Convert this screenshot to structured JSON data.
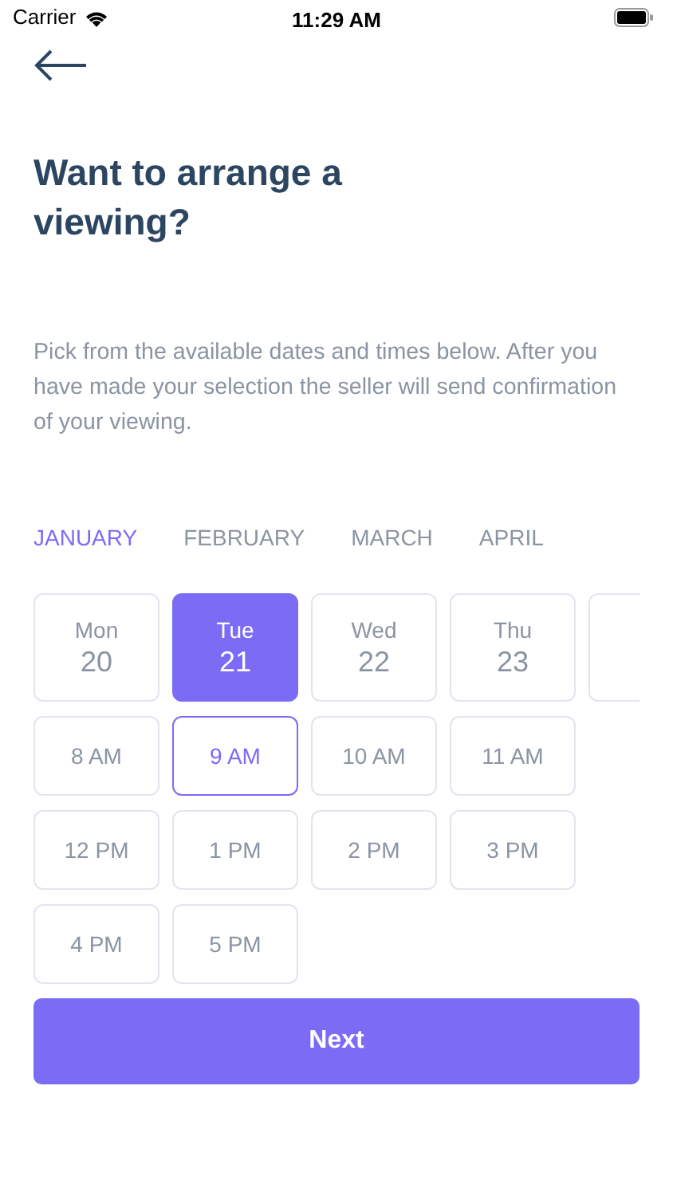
{
  "status_bar": {
    "carrier": "Carrier",
    "time": "11:29 AM"
  },
  "title": "Want to arrange a viewing?",
  "description": "Pick from the available dates and times below. After you have made your selection the seller will send confirmation of your viewing.",
  "months": [
    {
      "label": "JANUARY",
      "selected": true
    },
    {
      "label": "FEBRUARY",
      "selected": false
    },
    {
      "label": "MARCH",
      "selected": false
    },
    {
      "label": "APRIL",
      "selected": false
    }
  ],
  "days": [
    {
      "kind": "day",
      "weekday": "Mon",
      "date": "20",
      "selected": false
    },
    {
      "kind": "day",
      "weekday": "Tue",
      "date": "21",
      "selected": true
    },
    {
      "kind": "day",
      "weekday": "Wed",
      "date": "22",
      "selected": false
    },
    {
      "kind": "day",
      "weekday": "Thu",
      "date": "23",
      "selected": false
    },
    {
      "kind": "partial",
      "selected": false
    }
  ],
  "times": [
    {
      "label": "8 AM",
      "selected": false
    },
    {
      "label": "9 AM",
      "selected": true
    },
    {
      "label": "10 AM",
      "selected": false
    },
    {
      "label": "11 AM",
      "selected": false
    },
    {
      "label": "12 PM",
      "selected": false
    },
    {
      "label": "1 PM",
      "selected": false
    },
    {
      "label": "2 PM",
      "selected": false
    },
    {
      "label": "3 PM",
      "selected": false
    },
    {
      "label": "4 PM",
      "selected": false
    },
    {
      "label": "5 PM",
      "selected": false
    }
  ],
  "next_button": "Next"
}
